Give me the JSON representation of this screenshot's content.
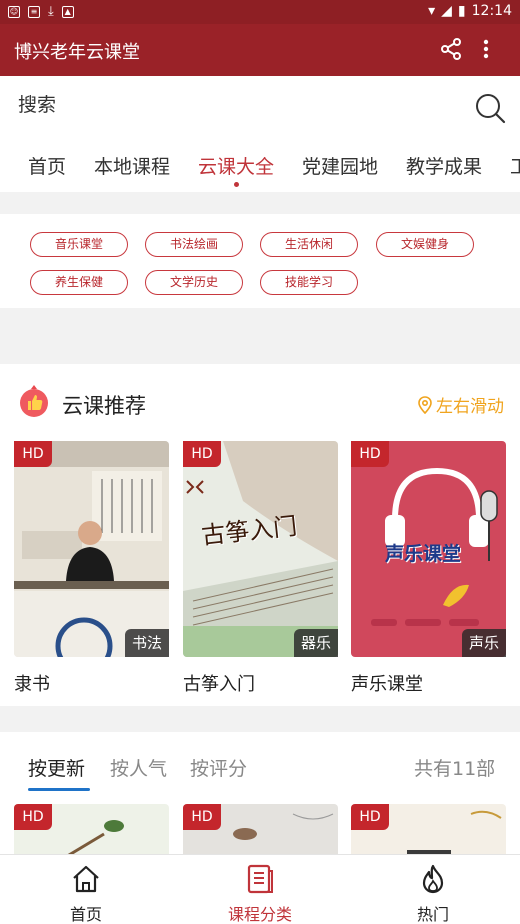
{
  "statusbar": {
    "time": "12:14"
  },
  "appbar": {
    "title": "博兴老年云课堂"
  },
  "search": {
    "label": "搜索"
  },
  "tabs": [
    "首页",
    "本地课程",
    "云课大全",
    "党建园地",
    "教学成果",
    "工"
  ],
  "categories": [
    "音乐课堂",
    "书法绘画",
    "生活休闲",
    "文娱健身",
    "养生保健",
    "文学历史",
    "技能学习"
  ],
  "recommend": {
    "title": "云课推荐",
    "hint": "左右滑动",
    "cards": [
      {
        "name": "隶书",
        "tag": "书法",
        "hd": "HD"
      },
      {
        "name": "古筝入门",
        "tag": "器乐",
        "hd": "HD",
        "overlay": "古筝入门"
      },
      {
        "name": "声乐课堂",
        "tag": "声乐",
        "hd": "HD",
        "overlay": "声乐课堂"
      }
    ]
  },
  "sort": {
    "options": [
      "按更新",
      "按人气",
      "按评分"
    ],
    "count": "共有11部"
  },
  "mini_cards": [
    {
      "hd": "HD"
    },
    {
      "hd": "HD"
    },
    {
      "hd": "HD"
    }
  ],
  "bottom_nav": [
    "首页",
    "课程分类",
    "热门"
  ],
  "colors": {
    "primary": "#9a2228",
    "accent": "#c0343a",
    "hint": "#f0a41e",
    "underline": "#1f73c8"
  }
}
